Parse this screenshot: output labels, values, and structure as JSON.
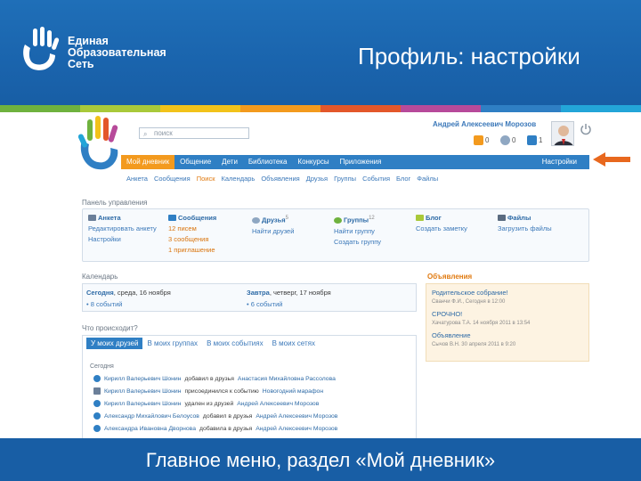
{
  "slide": {
    "logo_lines": [
      "Единая",
      "Образовательная",
      "Сеть"
    ],
    "title": "Профиль: настройки",
    "caption": "Главное меню, раздел «Мой дневник»",
    "stripe_colors": [
      "#6fb23e",
      "#a9c93a",
      "#f2c21a",
      "#f39a1e",
      "#e3572a",
      "#b74a9a",
      "#2f7fc4",
      "#23a5d8"
    ]
  },
  "site": {
    "search_placeholder": "поиск",
    "user_name": "Андрей Алексеевич Морозов",
    "counters": [
      "0",
      "0",
      "1"
    ],
    "menu": [
      "Мой дневник",
      "Общение",
      "Дети",
      "Библиотека",
      "Конкурсы",
      "Приложения"
    ],
    "menu_settings": "Настройки",
    "submenu": [
      "Анкета",
      "Сообщения",
      "Поиск",
      "Календарь",
      "Объявления",
      "Друзья",
      "Группы",
      "События",
      "Блог",
      "Файлы"
    ],
    "panel_title": "Панель управления",
    "panel": [
      {
        "head": "Анкета",
        "lines": [
          "Редактировать анкету",
          "Настройки"
        ]
      },
      {
        "head": "Сообщения",
        "lines": [
          "12 писем",
          "3 сообщения",
          "1 приглашение"
        ]
      },
      {
        "head": "Друзья",
        "sup": "5",
        "lines": [
          "Найти друзей"
        ]
      },
      {
        "head": "Группы",
        "sup": "12",
        "lines": [
          "Найти группу",
          "Создать группу"
        ]
      },
      {
        "head": "Блог",
        "lines": [
          "Создать заметку"
        ]
      },
      {
        "head": "Файлы",
        "lines": [
          "Загрузить файлы"
        ]
      }
    ],
    "calendar_title": "Календарь",
    "cal_today_label": "Сегодня",
    "cal_today_date": ", среда, 16 ноября",
    "cal_today_events": "• 8 событий",
    "cal_tomorrow_label": "Завтра",
    "cal_tomorrow_date": ", четверг, 17 ноября",
    "cal_tomorrow_events": "• 6 событий",
    "ads_title": "Объявления",
    "ads": [
      {
        "title": "Родительское собрание!",
        "meta": "Сванчи Ф.И., Сегодня в 12:00"
      },
      {
        "title": "СРОЧНО!",
        "meta": "Хачатурова Т.А. 14 ноября 2011 в 13:54"
      },
      {
        "title": "Объявление",
        "meta": "Сычов В.Н. 30 апреля 2011 в 9:20"
      }
    ],
    "feed_title": "Что происходит?",
    "feed_tabs": [
      "У моих друзей",
      "В моих группах",
      "В моих событиях",
      "В моих сетях"
    ],
    "feed_today": "Сегодня",
    "feed": [
      {
        "name": "Кирилл Валерьевич Шонин",
        "action": "добавил в друзья",
        "target": "Анастасия Михайловна Рассолова"
      },
      {
        "name": "Кирилл Валерьевич Шонин",
        "action": "присоединился к событию",
        "target": "Новогодний марафон"
      },
      {
        "name": "Кирилл Валерьевич Шонин",
        "action": "удален из друзей",
        "target": "Андрей Алексеевич Морозов"
      },
      {
        "name": "Александр Михайлович Белоусов",
        "action": "добавил в друзья",
        "target": "Андрей Алексеевич Морозов"
      },
      {
        "name": "Александра Ивановна Дворнова",
        "action": "добавила в друзья",
        "target": "Андрей Алексеевич Морозов"
      }
    ]
  }
}
